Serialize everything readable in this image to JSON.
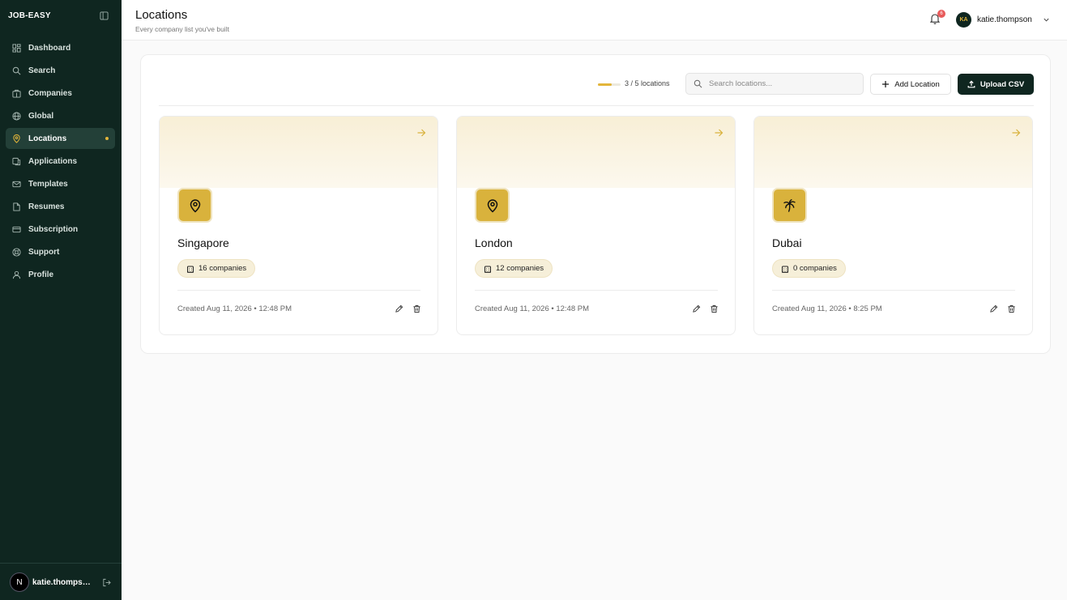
{
  "brand": "JOB-EASY",
  "nav": [
    {
      "label": "Dashboard",
      "icon": "dashboard-icon"
    },
    {
      "label": "Search",
      "icon": "search-icon"
    },
    {
      "label": "Companies",
      "icon": "building-icon"
    },
    {
      "label": "Global",
      "icon": "globe-icon"
    },
    {
      "label": "Locations",
      "icon": "map-pin-icon",
      "active": true
    },
    {
      "label": "Applications",
      "icon": "applications-icon"
    },
    {
      "label": "Templates",
      "icon": "mail-icon"
    },
    {
      "label": "Resumes",
      "icon": "file-icon"
    },
    {
      "label": "Subscription",
      "icon": "card-icon"
    },
    {
      "label": "Support",
      "icon": "lifebuoy-icon"
    },
    {
      "label": "Profile",
      "icon": "user-icon"
    }
  ],
  "sidebar_footer": {
    "avatar_letter": "N",
    "username": "katie.thompson"
  },
  "header": {
    "title": "Locations",
    "subtitle": "Every company list you've built",
    "notification_count": "6",
    "user_initials": "KA",
    "user_name": "katie.thompson"
  },
  "toolbar": {
    "count_label": "3 / 5 locations",
    "progress_fraction": 0.6,
    "search_placeholder": "Search locations...",
    "add_label": "Add Location",
    "upload_label": "Upload CSV"
  },
  "colors": {
    "sidebar_bg": "#0f2620",
    "accent": "#e3b53a",
    "icon_tile": "#d9b23c"
  },
  "locations": [
    {
      "name": "Singapore",
      "companies": "16 companies",
      "created": "Created Aug 11, 2026 • 12:48 PM",
      "icon": "map-pin-icon"
    },
    {
      "name": "London",
      "companies": "12 companies",
      "created": "Created Aug 11, 2026 • 12:48 PM",
      "icon": "map-pin-icon"
    },
    {
      "name": "Dubai",
      "companies": "0 companies",
      "created": "Created Aug 11, 2026 • 8:25 PM",
      "icon": "palm-tree-icon"
    }
  ]
}
